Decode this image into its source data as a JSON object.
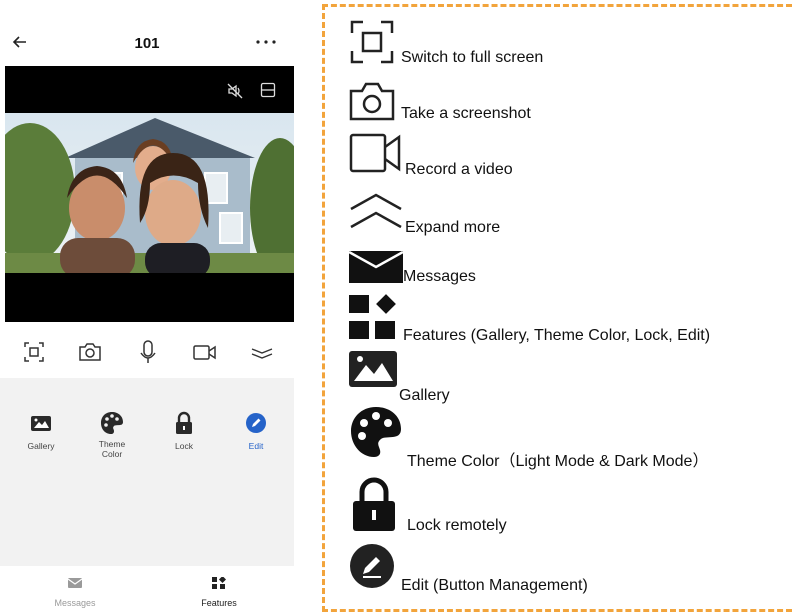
{
  "phone": {
    "header": {
      "title": "101"
    },
    "controls": [
      "fullscreen-icon",
      "camera-icon",
      "microphone-icon",
      "video-icon",
      "chevron-icon"
    ],
    "features": [
      {
        "label": "Gallery",
        "icon": "gallery-icon"
      },
      {
        "label": "Theme Color",
        "icon": "palette-icon"
      },
      {
        "label": "Lock",
        "icon": "lock-icon"
      },
      {
        "label": "Edit",
        "icon": "edit-icon"
      }
    ],
    "nav": [
      {
        "label": "Messages",
        "icon": "envelope-icon",
        "active": false
      },
      {
        "label": "Features",
        "icon": "grid-icon",
        "active": true
      }
    ],
    "accent_color": "#2563c9"
  },
  "legend": {
    "border_color": "#f2a43c",
    "items": [
      {
        "icon": "fullscreen-icon",
        "text": "Switch to full screen"
      },
      {
        "icon": "camera-icon",
        "text": "Take a screenshot"
      },
      {
        "icon": "video-icon",
        "text": "Record a video"
      },
      {
        "icon": "expand-icon",
        "text": "Expand more"
      },
      {
        "icon": "envelope-icon",
        "text": "Messages"
      },
      {
        "icon": "grid-icon",
        "text": "Features (Gallery, Theme Color, Lock, Edit)"
      },
      {
        "icon": "gallery-icon",
        "text": "Gallery"
      },
      {
        "icon": "palette-icon",
        "text": "Theme Color（Light Mode & Dark Mode）"
      },
      {
        "icon": "lock-icon",
        "text": "Lock remotely"
      },
      {
        "icon": "edit-icon",
        "text": "Edit (Button Management)"
      }
    ]
  }
}
